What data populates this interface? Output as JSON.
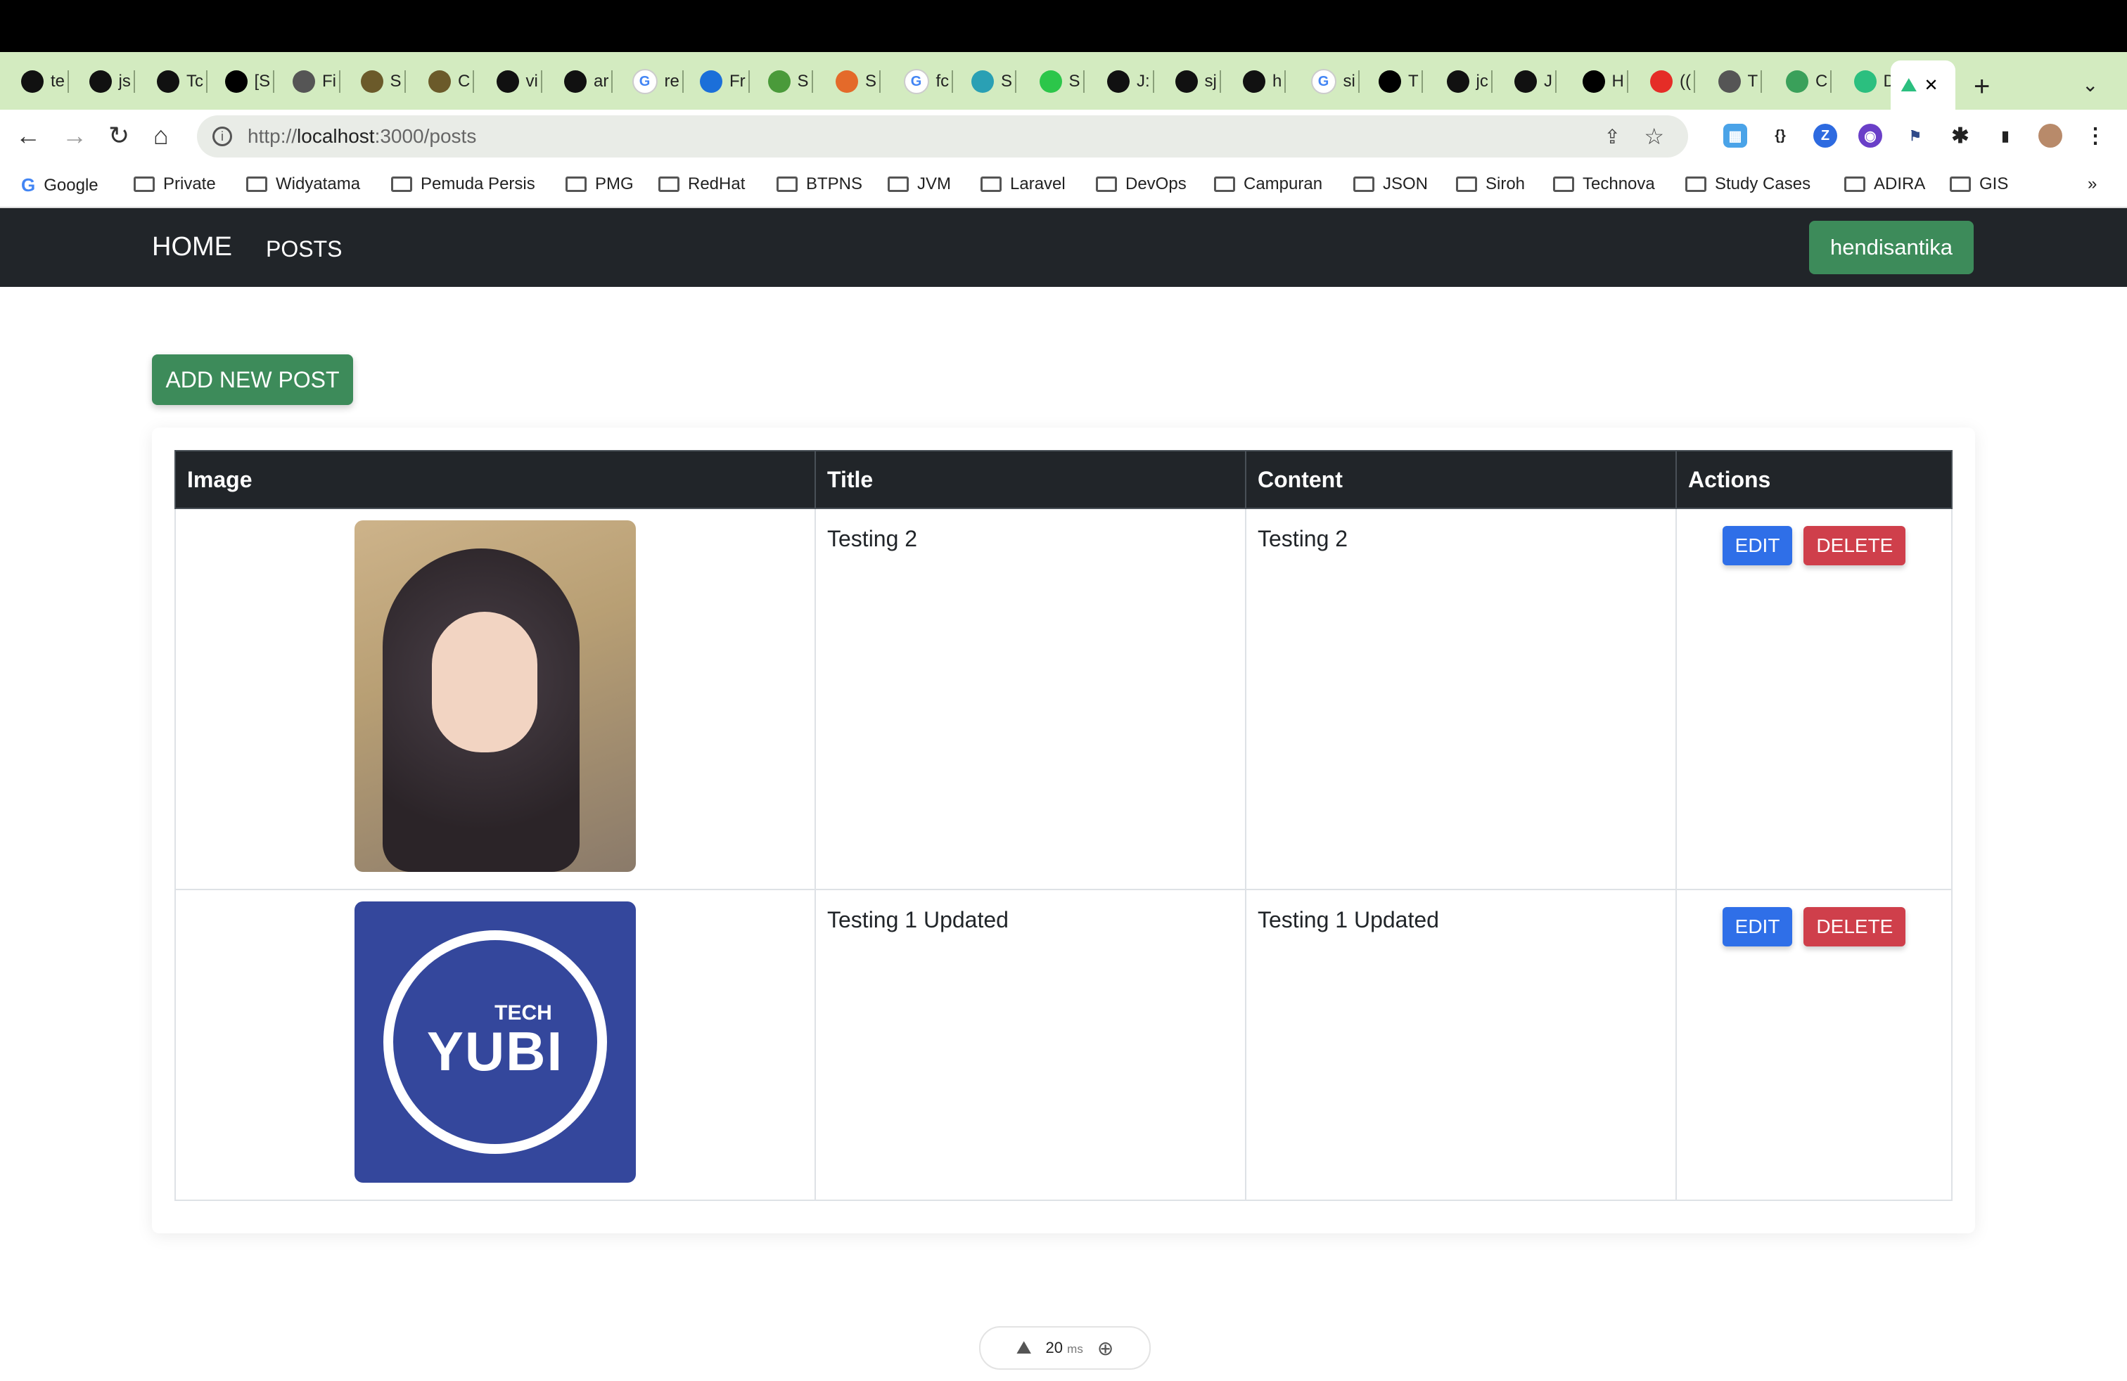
{
  "browser": {
    "tabs": [
      {
        "label": "te",
        "icon": "github-icon"
      },
      {
        "label": "js",
        "icon": "github-icon"
      },
      {
        "label": "Tc",
        "icon": "jet-icon"
      },
      {
        "label": "[S",
        "icon": "medium-icon"
      },
      {
        "label": "Fi",
        "icon": "globe-icon"
      },
      {
        "label": "S",
        "icon": "persis-icon"
      },
      {
        "label": "C",
        "icon": "persis-icon"
      },
      {
        "label": "vi",
        "icon": "github-icon"
      },
      {
        "label": "ar",
        "icon": "github-icon"
      },
      {
        "label": "re",
        "icon": "google-icon"
      },
      {
        "label": "Fr",
        "icon": "flutter-icon"
      },
      {
        "label": "S",
        "icon": "spring-icon"
      },
      {
        "label": "S",
        "icon": "java-icon"
      },
      {
        "label": "fc",
        "icon": "google-icon"
      },
      {
        "label": "S",
        "icon": "jhipster-icon"
      },
      {
        "label": "S",
        "icon": "dollar-icon"
      },
      {
        "label": "J:",
        "icon": "github-icon"
      },
      {
        "label": "sj",
        "icon": "github-icon"
      },
      {
        "label": "h",
        "icon": "github-icon"
      },
      {
        "label": "si",
        "icon": "google-icon"
      },
      {
        "label": "T",
        "icon": "medium-icon"
      },
      {
        "label": "jc",
        "icon": "github-icon"
      },
      {
        "label": "J",
        "icon": "github-icon"
      },
      {
        "label": "H",
        "icon": "medium-icon"
      },
      {
        "label": "((",
        "icon": "youtube-icon"
      },
      {
        "label": "T",
        "icon": "app-icon"
      },
      {
        "label": "C",
        "icon": "green-icon"
      },
      {
        "label": "D",
        "icon": "nuxt-icon"
      }
    ],
    "active_tab": {
      "label": "",
      "close": "✕"
    },
    "new_tab": "+",
    "url_prefix": "http://",
    "url_host": "localhost",
    "url_rest": ":3000/posts",
    "bookmarks": [
      "Google",
      "Private",
      "Widyatama",
      "Pemuda Persis",
      "PMG",
      "RedHat",
      "BTPNS",
      "JVM",
      "Laravel",
      "DevOps",
      "Campuran",
      "JSON",
      "Siroh",
      "Technova",
      "Study Cases",
      "ADIRA",
      "GIS"
    ],
    "more": "»"
  },
  "navbar": {
    "brand": "HOME",
    "link": "POSTS",
    "user": "hendisantika"
  },
  "page": {
    "add_button": "ADD NEW POST",
    "columns": [
      "Image",
      "Title",
      "Content",
      "Actions"
    ],
    "rows": [
      {
        "title": "Testing 2",
        "content": "Testing 2",
        "edit": "EDIT",
        "delete": "DELETE",
        "image": "portrait-photo"
      },
      {
        "title": "Testing 1 Updated",
        "content": "Testing 1 Updated",
        "edit": "EDIT",
        "delete": "DELETE",
        "image": "yubi-logo"
      }
    ],
    "logo_text_small": "TECH",
    "logo_text_big": "YUBI"
  },
  "devtools": {
    "time": "20",
    "unit": "ms"
  }
}
